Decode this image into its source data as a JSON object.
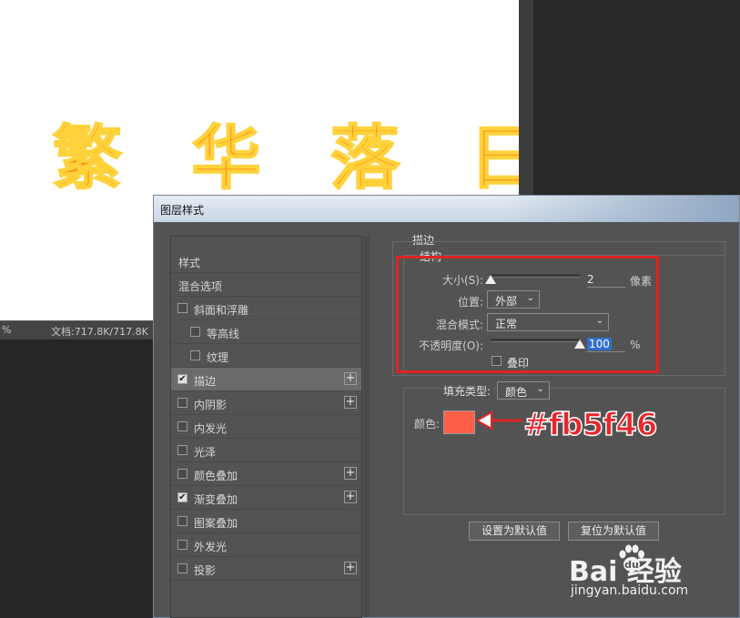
{
  "canvas": {
    "text": "繁 华 落 日"
  },
  "status_bar": {
    "zoom_suffix": "%",
    "doc_size": "文档:717.8K/717.8K"
  },
  "dialog": {
    "title": "图层样式",
    "styles_list": [
      {
        "label": "样式",
        "checkbox": false,
        "checked": false,
        "plus": false,
        "selected": false,
        "indent": 0
      },
      {
        "label": "混合选项",
        "checkbox": false,
        "checked": false,
        "plus": false,
        "selected": false,
        "indent": 0
      },
      {
        "label": "斜面和浮雕",
        "checkbox": true,
        "checked": false,
        "plus": false,
        "selected": false,
        "indent": 0
      },
      {
        "label": "等高线",
        "checkbox": true,
        "checked": false,
        "plus": false,
        "selected": false,
        "indent": 1
      },
      {
        "label": "纹理",
        "checkbox": true,
        "checked": false,
        "plus": false,
        "selected": false,
        "indent": 1
      },
      {
        "label": "描边",
        "checkbox": true,
        "checked": true,
        "plus": true,
        "selected": true,
        "indent": 0
      },
      {
        "label": "内阴影",
        "checkbox": true,
        "checked": false,
        "plus": true,
        "selected": false,
        "indent": 0
      },
      {
        "label": "内发光",
        "checkbox": true,
        "checked": false,
        "plus": false,
        "selected": false,
        "indent": 0
      },
      {
        "label": "光泽",
        "checkbox": true,
        "checked": false,
        "plus": false,
        "selected": false,
        "indent": 0
      },
      {
        "label": "颜色叠加",
        "checkbox": true,
        "checked": false,
        "plus": true,
        "selected": false,
        "indent": 0
      },
      {
        "label": "渐变叠加",
        "checkbox": true,
        "checked": true,
        "plus": true,
        "selected": false,
        "indent": 0
      },
      {
        "label": "图案叠加",
        "checkbox": true,
        "checked": false,
        "plus": false,
        "selected": false,
        "indent": 0
      },
      {
        "label": "外发光",
        "checkbox": true,
        "checked": false,
        "plus": false,
        "selected": false,
        "indent": 0
      },
      {
        "label": "投影",
        "checkbox": true,
        "checked": false,
        "plus": true,
        "selected": false,
        "indent": 0
      }
    ],
    "stroke": {
      "section_title": "描边",
      "structure_legend": "结构",
      "size_label": "大小(S):",
      "size_value": "2",
      "size_unit": "像素",
      "size_level": 0.0,
      "position_label": "位置:",
      "position_value": "外部",
      "blend_mode_label": "混合模式:",
      "blend_mode_value": "正常",
      "opacity_label": "不透明度(O):",
      "opacity_value": "100",
      "opacity_unit": "%",
      "opacity_level": 1.0,
      "overprint_label": "叠印",
      "overprint_checked": false,
      "fill_type_label": "填充类型:",
      "fill_type_value": "颜色",
      "color_label": "颜色:",
      "color_hex": "#fb5f46"
    },
    "buttons": {
      "make_default": "设置为默认值",
      "reset_default": "复位为默认值"
    }
  },
  "annotation": {
    "hex_label": "#fb5f46"
  },
  "watermark": {
    "brand": "Bai  经验",
    "url": "jingyan.baidu.com"
  },
  "colors": {
    "highlight": "#e02323",
    "annotation_text": "#e8262c",
    "swatch": "#fb5f46"
  }
}
